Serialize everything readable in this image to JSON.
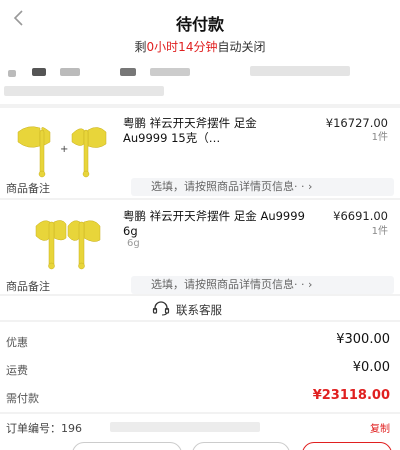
{
  "header": {
    "title": "待付款",
    "countdown_prefix": "剩",
    "countdown_time": "0小时14分钟",
    "countdown_suffix": "自动关闭"
  },
  "products": [
    {
      "name": "粤鹏 祥云开天斧摆件 足金 Au9999 15克（…",
      "spec": "",
      "price": "¥16727.00",
      "qty": "1件",
      "remark_label": "商品备注",
      "remark_placeholder": "选填，请按照商品详情页信息· · ›"
    },
    {
      "name": "粤鹏 祥云开天斧摆件 足金 Au9999 6g",
      "spec": "6g",
      "price": "¥6691.00",
      "qty": "1件",
      "remark_label": "商品备注",
      "remark_placeholder": "选填，请按照商品详情页信息· · ›"
    }
  ],
  "service": {
    "label": "联系客服"
  },
  "fees": {
    "discount_label": "优惠",
    "discount_value": "¥300.00",
    "shipping_label": "运费",
    "shipping_value": "¥0.00",
    "payable_label": "需付款",
    "payable_value": "¥23118.00"
  },
  "order": {
    "number_label": "订单编号：",
    "number_value": "196",
    "copy_label": "复制"
  },
  "colors": {
    "accent": "#e02020",
    "gold": "#e8c632"
  }
}
